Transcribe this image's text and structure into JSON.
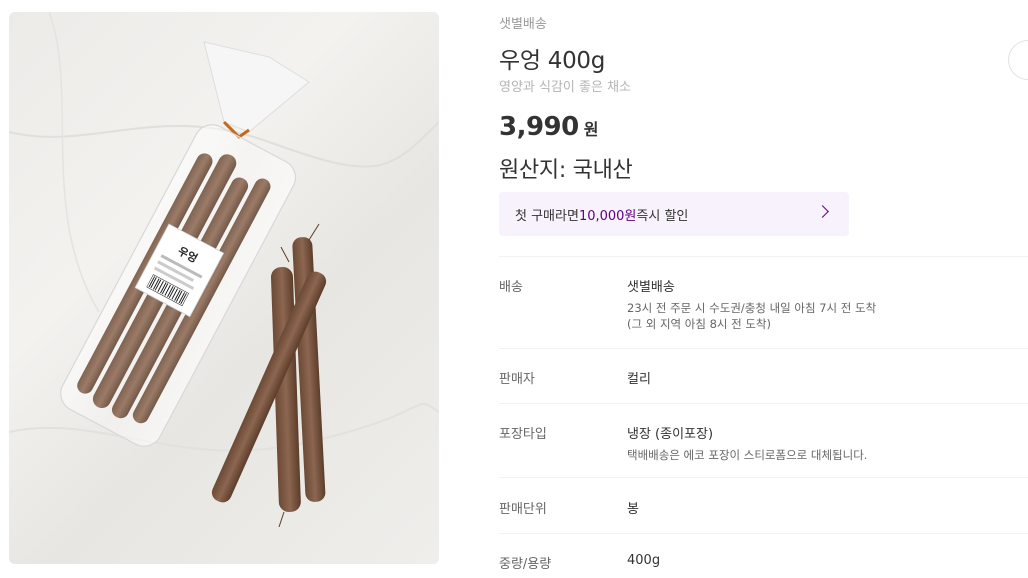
{
  "product": {
    "delivery_tag": "샛별배송",
    "title": "우엉 400g",
    "subtitle": "영양과 식감이 좋은 채소",
    "price": "3,990",
    "currency": "원",
    "origin": "원산지: 국내산",
    "image_label": {
      "name": "우엉"
    }
  },
  "coupon": {
    "prefix": "첫 구매라면 ",
    "amount": "10,000원",
    "suffix": " 즉시 할인"
  },
  "details": [
    {
      "label": "배송",
      "value": "샛별배송",
      "sub": [
        "23시 전 주문 시 수도권/충청 내일 아침 7시 전 도착",
        "(그 외 지역 아침 8시 전 도착)"
      ]
    },
    {
      "label": "판매자",
      "value": "컬리",
      "sub": []
    },
    {
      "label": "포장타입",
      "value": "냉장 (종이포장)",
      "sub": [
        "택배배송은 에코 포장이 스티로폼으로 대체됩니다."
      ]
    },
    {
      "label": "판매단위",
      "value": "봉",
      "sub": []
    },
    {
      "label": "중량/용량",
      "value": "400g",
      "sub": []
    }
  ],
  "colors": {
    "accent": "#5f0080",
    "coupon_bg": "#f7f2fb",
    "muted": "#999999"
  },
  "icons": {
    "coupon_arrow": "chevron-right-icon",
    "share": "share-icon"
  }
}
